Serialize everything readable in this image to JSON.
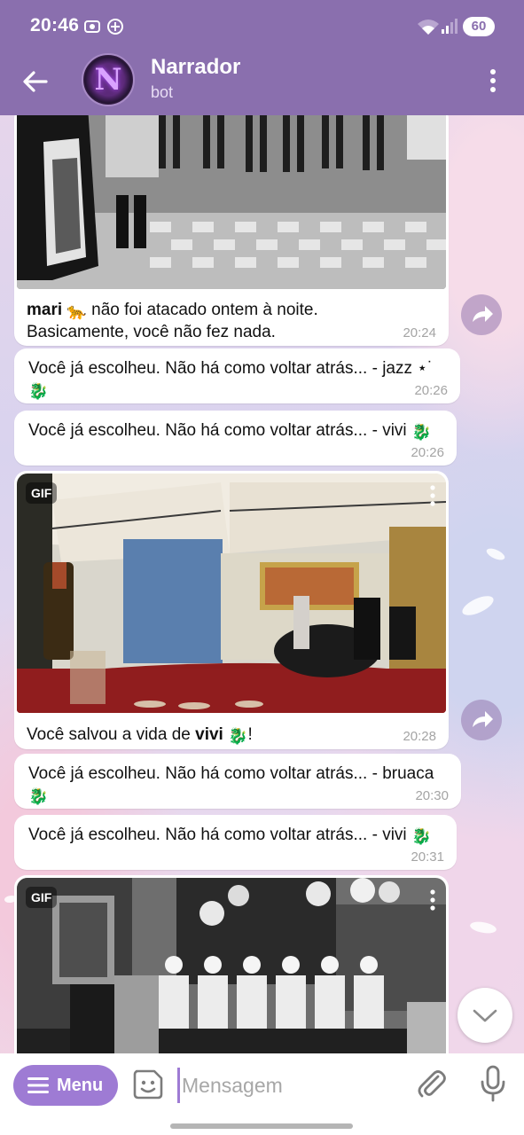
{
  "status_bar": {
    "time": "20:46",
    "battery": "60"
  },
  "header": {
    "title": "Narrador",
    "subtitle": "bot",
    "avatar_letter": "N"
  },
  "messages": [
    {
      "kind": "media-caption",
      "name": "mari",
      "emoji": "leopard-emoji",
      "line1_rest": " não foi atacado ontem à noite.",
      "line2": "Basicamente, você não fez nada.",
      "time": "20:24"
    },
    {
      "kind": "text",
      "text": "Você já escolheu. Não há como voltar atrás... - jazz ⋆˙",
      "time": "20:26"
    },
    {
      "kind": "text",
      "text": "Você já escolheu. Não há como voltar atrás... - vivi",
      "time": "20:26"
    },
    {
      "kind": "gif",
      "badge": "GIF",
      "caption_pre": "Você salvou a vida de ",
      "caption_name": "vivi",
      "caption_post": "!",
      "time": "20:28"
    },
    {
      "kind": "text",
      "text": "Você já escolheu. Não há como voltar atrás... - bruaca",
      "time": "20:30"
    },
    {
      "kind": "text",
      "text": "Você já escolheu. Não há como voltar atrás... - vivi",
      "time": "20:31"
    },
    {
      "kind": "gif",
      "badge": "GIF"
    }
  ],
  "input_bar": {
    "menu_label": "Menu",
    "placeholder": "Mensagem"
  },
  "colors": {
    "header": "#8a6fae",
    "accent": "#9e7bd4",
    "bubble": "#ffffff"
  }
}
